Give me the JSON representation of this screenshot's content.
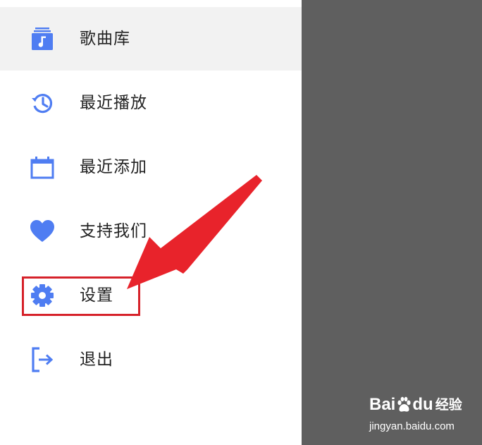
{
  "colors": {
    "icon_blue": "#4f7df2",
    "highlight_red": "#d6222a",
    "scrim_gray": "#5f5f5f",
    "selected_bg": "#f2f2f2"
  },
  "menu": {
    "items": [
      {
        "label": "歌曲库",
        "icon": "music-library-icon",
        "selected": true
      },
      {
        "label": "最近播放",
        "icon": "history-icon"
      },
      {
        "label": "最近添加",
        "icon": "calendar-icon"
      },
      {
        "label": "支持我们",
        "icon": "heart-icon"
      },
      {
        "label": "设置",
        "icon": "gear-icon"
      },
      {
        "label": "退出",
        "icon": "exit-icon"
      }
    ]
  },
  "watermark": {
    "brand_latin_1": "Bai",
    "brand_latin_2": "du",
    "brand_cn": "经验",
    "url": "jingyan.baidu.com"
  }
}
